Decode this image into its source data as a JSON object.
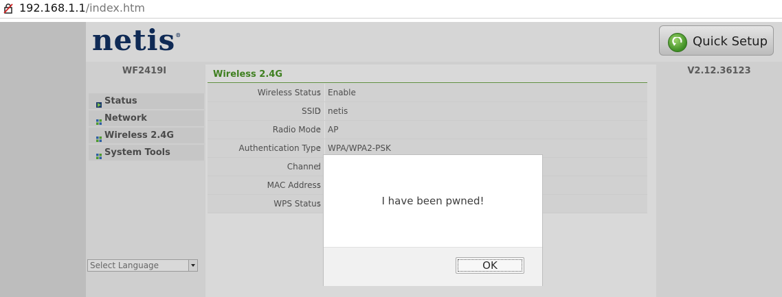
{
  "address_bar": {
    "host": "192.168.1.1",
    "path": "/index.htm"
  },
  "header": {
    "logo_text": "netis",
    "logo_mark": "®",
    "quick_setup_label": "Quick Setup"
  },
  "sidebar": {
    "model": "WF2419I",
    "items": [
      {
        "label": "Status",
        "icon": "play-arrow-icon"
      },
      {
        "label": "Network",
        "icon": "grid-icon"
      },
      {
        "label": "Wireless 2.4G",
        "icon": "grid-icon"
      },
      {
        "label": "System Tools",
        "icon": "grid-icon"
      }
    ],
    "language_placeholder": "Select Language"
  },
  "main": {
    "section_title": "Wireless 2.4G",
    "rows": [
      {
        "label": "Wireless Status",
        "value": "Enable"
      },
      {
        "label": "SSID",
        "value": "netis"
      },
      {
        "label": "Radio Mode",
        "value": "AP"
      },
      {
        "label": "Authentication Type",
        "value": "WPA/WPA2-PSK"
      },
      {
        "label": "Channel",
        "value": ""
      },
      {
        "label": "MAC Address",
        "value": ""
      },
      {
        "label": "WPS Status",
        "value": ""
      }
    ]
  },
  "version": "V2.12.36123",
  "dialog": {
    "message": "I have been pwned!",
    "ok_label": "OK"
  },
  "colors": {
    "accent_green": "#3e7f1f",
    "logo_navy": "#0f2a55"
  }
}
